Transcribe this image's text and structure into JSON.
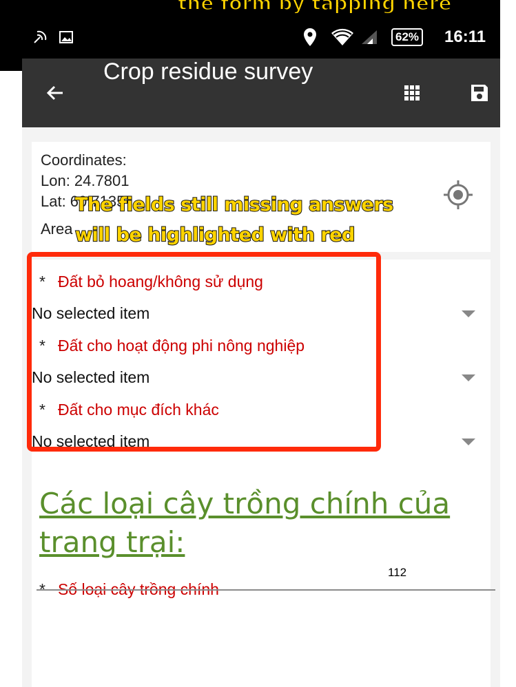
{
  "banner": {
    "text": "the form by tapping here"
  },
  "status_bar": {
    "battery": "62%",
    "time": "16:11"
  },
  "app_bar": {
    "title": "Crop residue survey"
  },
  "coordinates": {
    "label": "Coordinates:",
    "lon": "Lon: 24.7801",
    "lat": "Lat: 6",
    "lat_partial": "0.7135",
    "area": "Area"
  },
  "overlay": {
    "caption_line1": "The fields still missing answers",
    "caption_line2": "will be highlighted with red"
  },
  "fields": [
    {
      "label": "Đất bỏ hoang/không sử dụng",
      "value": "No selected item"
    },
    {
      "label": "Đất cho hoạt động phi nông nghiệp",
      "value": "No selected item"
    },
    {
      "label": "Đất cho mục đích khác",
      "value": "No selected item"
    }
  ],
  "required_marker": "*",
  "section": {
    "title": "Các loại cây trồng chính của trang trại:"
  },
  "crop_count": {
    "label": "Số loại cây trồng chính",
    "value": "112"
  },
  "colors": {
    "required_label": "#cc0000",
    "section_title": "#5a8f2c",
    "highlight": "#ff2a0a",
    "caption": "#ffd400",
    "app_bar": "#333333"
  },
  "icons": [
    "back-arrow-icon",
    "grid-icon",
    "save-icon",
    "gps-locate-icon",
    "wifi-icon",
    "signal-icon",
    "location-pin-icon",
    "image-icon",
    "nfc-icon"
  ]
}
